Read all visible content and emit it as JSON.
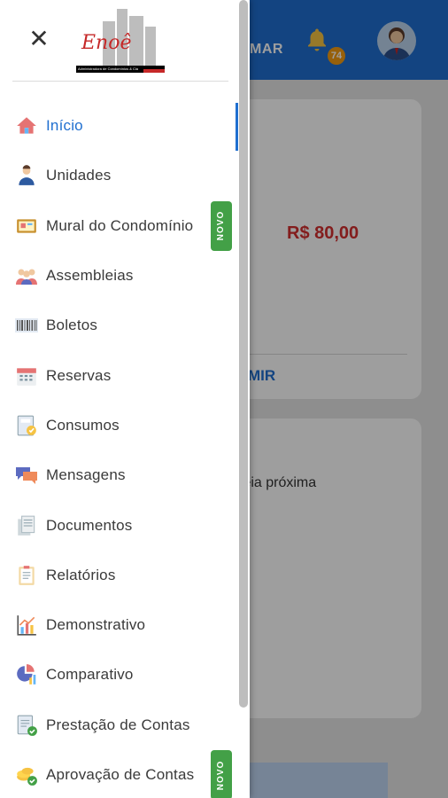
{
  "background": {
    "topbar_action": "MAR",
    "notification_count": "74",
    "price": "R$ 80,00",
    "card_action": "MIR",
    "card_text": "oleia próxima"
  },
  "drawer": {
    "logo_text": "Enoê",
    "logo_subtext": "Administradora de Condomínios & Cia",
    "items": [
      {
        "label": "Início",
        "icon": "home-icon",
        "active": true
      },
      {
        "label": "Unidades",
        "icon": "person-icon"
      },
      {
        "label": "Mural do Condomínio",
        "icon": "noticeboard-icon",
        "badge": "NOVO"
      },
      {
        "label": "Assembleias",
        "icon": "group-icon"
      },
      {
        "label": "Boletos",
        "icon": "barcode-icon"
      },
      {
        "label": "Reservas",
        "icon": "calendar-icon"
      },
      {
        "label": "Consumos",
        "icon": "meter-icon"
      },
      {
        "label": "Mensagens",
        "icon": "chat-icon"
      },
      {
        "label": "Documentos",
        "icon": "documents-icon"
      },
      {
        "label": "Relatórios",
        "icon": "clipboard-icon"
      },
      {
        "label": "Demonstrativo",
        "icon": "chart-icon"
      },
      {
        "label": "Comparativo",
        "icon": "comparison-chart-icon"
      },
      {
        "label": "Prestação de Contas",
        "icon": "accounts-icon"
      },
      {
        "label": "Aprovação de Contas",
        "icon": "coins-approve-icon",
        "badge": "NOVO"
      }
    ]
  },
  "colors": {
    "primary": "#1f6fd0",
    "badge_green": "#43a047",
    "price_red": "#d32f2f"
  }
}
